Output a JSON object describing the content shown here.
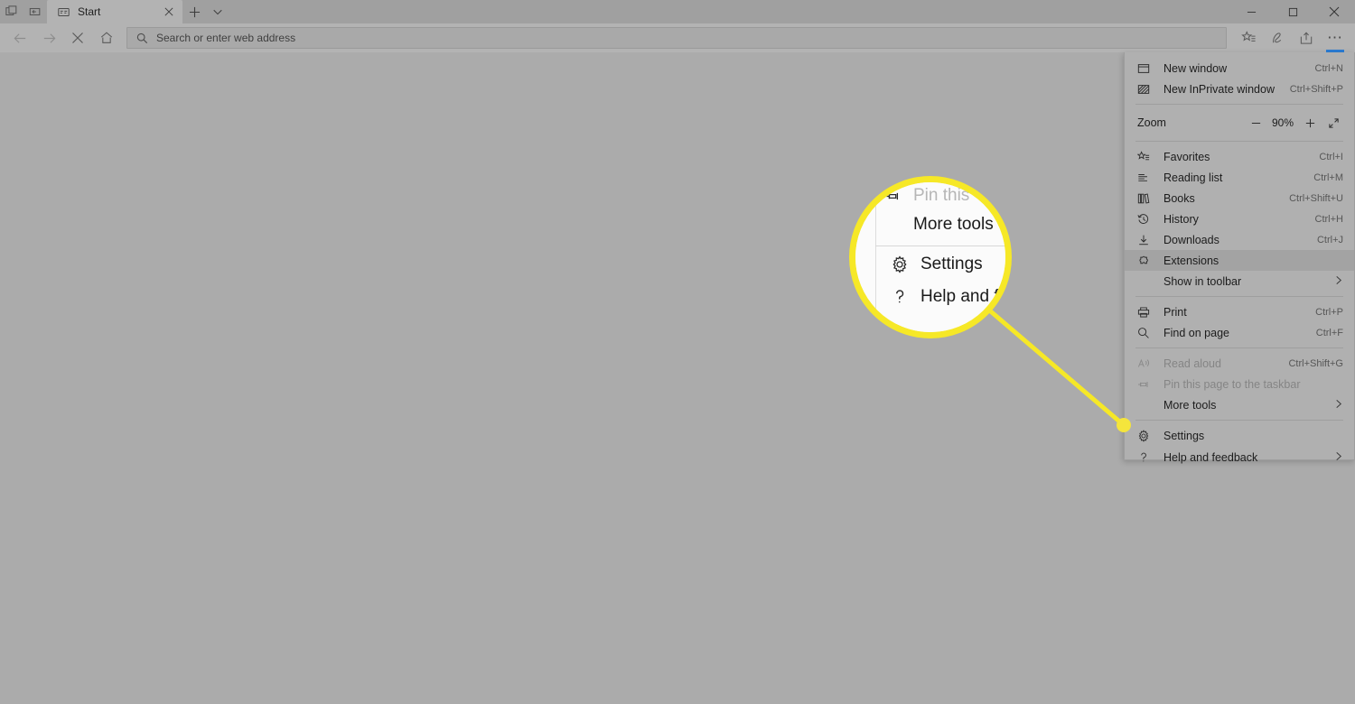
{
  "window": {
    "titlebar": {
      "tab_preview_icon": "tab-preview-icon",
      "set_aside_icon": "set-tabs-aside-icon",
      "tab": {
        "favicon": "start-page-icon",
        "title": "Start",
        "close_icon": "close-tab-icon"
      },
      "new_tab_icon": "new-tab-plus-icon",
      "tab_menu_icon": "tab-dropdown-chevron-icon",
      "controls": {
        "minimize": "minimize-icon",
        "maximize": "maximize-icon",
        "close": "close-window-icon"
      }
    },
    "navbar": {
      "back_icon": "back-arrow-icon",
      "forward_icon": "forward-arrow-icon",
      "stop_icon": "stop-loading-x-icon",
      "home_icon": "home-icon",
      "address": {
        "search_icon": "search-icon",
        "value": "",
        "placeholder": "Search or enter web address"
      },
      "favorites_icon": "add-to-favorites-icon",
      "notes_icon": "make-a-web-note-icon",
      "share_icon": "share-icon",
      "more_icon": "more-settings-ellipsis-icon"
    }
  },
  "menu": {
    "items": [
      {
        "id": "new-window",
        "icon": "new-window-icon",
        "label": "New window",
        "accel": "Ctrl+N",
        "chevron": false,
        "disabled": false,
        "highlight": false
      },
      {
        "id": "new-inprivate",
        "icon": "inprivate-window-icon",
        "label": "New InPrivate window",
        "accel": "Ctrl+Shift+P",
        "chevron": false,
        "disabled": false,
        "highlight": false
      }
    ],
    "zoom": {
      "label": "Zoom",
      "minus_icon": "zoom-out-minus-icon",
      "value": "90%",
      "plus_icon": "zoom-in-plus-icon",
      "fullscreen_icon": "fullscreen-expand-icon"
    },
    "items2": [
      {
        "id": "favorites",
        "icon": "favorites-star-icon",
        "label": "Favorites",
        "accel": "Ctrl+I",
        "chevron": false,
        "disabled": false,
        "highlight": false
      },
      {
        "id": "reading-list",
        "icon": "reading-list-icon",
        "label": "Reading list",
        "accel": "Ctrl+M",
        "chevron": false,
        "disabled": false,
        "highlight": false
      },
      {
        "id": "books",
        "icon": "books-icon",
        "label": "Books",
        "accel": "Ctrl+Shift+U",
        "chevron": false,
        "disabled": false,
        "highlight": false
      },
      {
        "id": "history",
        "icon": "history-clock-icon",
        "label": "History",
        "accel": "Ctrl+H",
        "chevron": false,
        "disabled": false,
        "highlight": false
      },
      {
        "id": "downloads",
        "icon": "downloads-arrow-icon",
        "label": "Downloads",
        "accel": "Ctrl+J",
        "chevron": false,
        "disabled": false,
        "highlight": false
      },
      {
        "id": "extensions",
        "icon": "extensions-puzzle-icon",
        "label": "Extensions",
        "accel": "",
        "chevron": false,
        "disabled": false,
        "highlight": true
      },
      {
        "id": "show-toolbar",
        "icon": "",
        "label": "Show in toolbar",
        "accel": "",
        "chevron": true,
        "disabled": false,
        "highlight": false
      }
    ],
    "items3": [
      {
        "id": "print",
        "icon": "printer-icon",
        "label": "Print",
        "accel": "Ctrl+P",
        "chevron": false,
        "disabled": false,
        "highlight": false
      },
      {
        "id": "find-on-page",
        "icon": "search-icon",
        "label": "Find on page",
        "accel": "Ctrl+F",
        "chevron": false,
        "disabled": false,
        "highlight": false
      }
    ],
    "items4": [
      {
        "id": "read-aloud",
        "icon": "read-aloud-icon",
        "label": "Read aloud",
        "accel": "Ctrl+Shift+G",
        "chevron": false,
        "disabled": true,
        "highlight": false
      },
      {
        "id": "pin-taskbar",
        "icon": "pin-icon",
        "label": "Pin this page to the taskbar",
        "accel": "",
        "chevron": false,
        "disabled": true,
        "highlight": false
      },
      {
        "id": "more-tools",
        "icon": "",
        "label": "More tools",
        "accel": "",
        "chevron": true,
        "disabled": false,
        "highlight": false
      }
    ],
    "items5": [
      {
        "id": "settings",
        "icon": "gear-icon",
        "label": "Settings",
        "accel": "",
        "chevron": false,
        "disabled": false,
        "highlight": false
      },
      {
        "id": "help-and-feedback",
        "icon": "question-mark-icon",
        "label": "Help and feedback",
        "accel": "",
        "chevron": true,
        "disabled": false,
        "highlight": false
      }
    ]
  },
  "callout": {
    "accent_color": "#f6e827",
    "dot_color": "#f5e53c",
    "magnified_items": {
      "pin_partial": "Pin this",
      "more_tools": "More tools",
      "settings": "Settings",
      "help_partial": "Help and fe"
    },
    "icons": {
      "pin": "pin-icon",
      "settings": "gear-icon",
      "help": "question-mark-icon"
    }
  }
}
